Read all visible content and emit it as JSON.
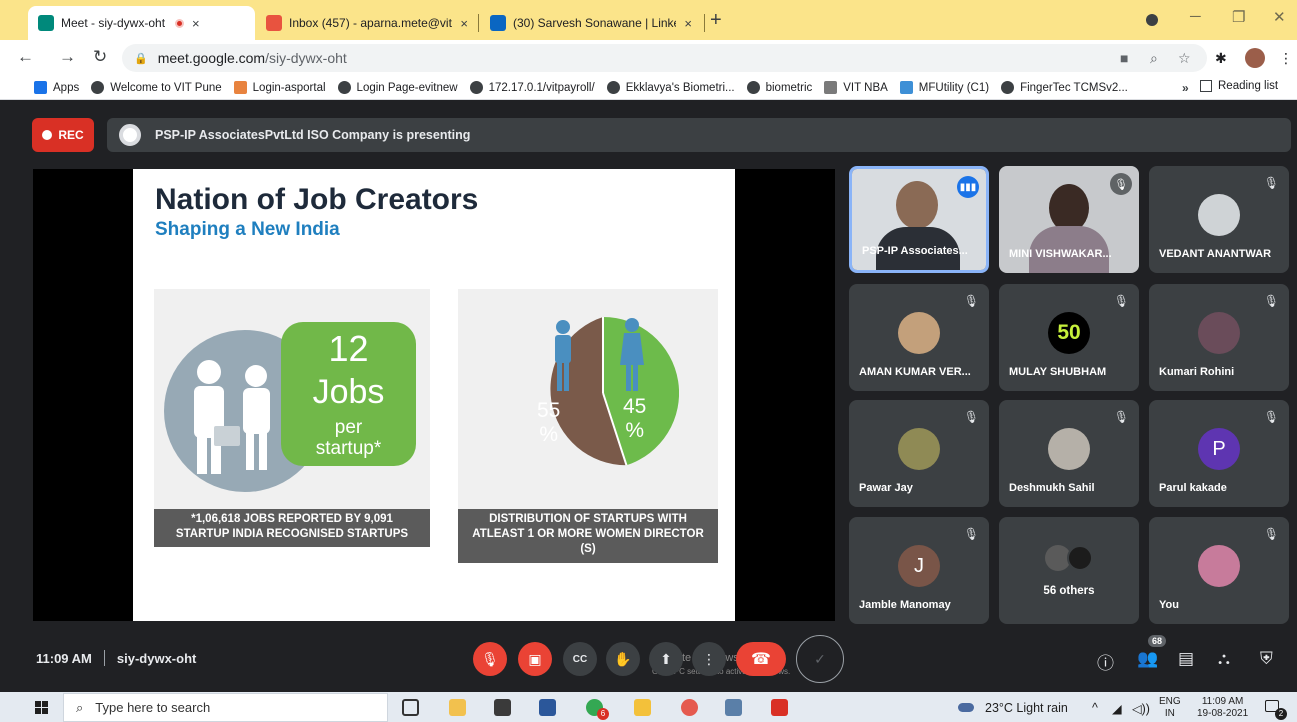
{
  "browser": {
    "tabs": [
      {
        "title": "Meet - siy-dywx-oht",
        "close": "×"
      },
      {
        "title": "Inbox (457) - aparna.mete@vit.e",
        "close": "×"
      },
      {
        "title": "(30) Sarvesh Sonawane | LinkedIn",
        "close": "×"
      }
    ],
    "new_tab": "+",
    "url_host": "meet.google.com",
    "url_path": "/siy-dywx-oht",
    "bookmarks": [
      "Apps",
      "Welcome to VIT Pune",
      "Login-asportal",
      "Login Page-evitnew",
      "172.17.0.1/vitpayroll/",
      "Ekklavya's Biometri...",
      "biometric",
      "VIT NBA",
      "MFUtility (C1)",
      "FingerTec TCMSv2..."
    ],
    "bookmarks_more": "»",
    "reading_list": "Reading list"
  },
  "meet": {
    "rec_label": "REC",
    "presenting_text": "PSP-IP AssociatesPvtLtd ISO Company is presenting",
    "slide": {
      "title": "Nation of Job Creators",
      "subtitle": "Shaping a New India",
      "jobs_number": "12",
      "jobs_label": "Jobs",
      "jobs_per": "per",
      "jobs_startup": "startup*",
      "caption1_line1": "*1,06,618 JOBS REPORTED BY 9,091",
      "caption1_line2": "STARTUP INDIA RECOGNISED STARTUPS",
      "pie_left_num": "55",
      "pie_left_pct": "%",
      "pie_right_num": "45",
      "pie_right_pct": "%",
      "caption2_line1": "DISTRIBUTION OF STARTUPS WITH",
      "caption2_line2": "ATLEAST 1 OR MORE WOMEN DIRECTOR",
      "caption2_line3": "(S)"
    },
    "activate_line1": "Activate Windows",
    "activate_line2": "Go to PC settings to activate Windows.",
    "participants": [
      "PSP-IP Associates...",
      "MINI VISHWAKAR...",
      "VEDANT ANANTWAR",
      "AMAN KUMAR VER...",
      "MULAY SHUBHAM",
      "Kumari Rohini",
      "Pawar Jay",
      "Deshmukh Sahil",
      "Parul kakade",
      "Jamble Manomay",
      "56 others",
      "You"
    ],
    "avatar_letters": {
      "parul": "P",
      "jamble": "J",
      "mulay": "50"
    },
    "time": "11:09 AM",
    "meeting_code": "siy-dywx-oht",
    "participant_count": "68",
    "colors": {
      "rec": "#d93025",
      "end_call": "#ea4335",
      "speaking": "#8ab4f8",
      "jobs_green": "#71b849",
      "pie_brown": "#7a5a4a",
      "pie_green": "#6dbb4b"
    }
  },
  "taskbar": {
    "search_placeholder": "Type here to search",
    "weather": "23°C  Light rain",
    "lang_1": "ENG",
    "lang_2": "IN",
    "clock_time": "11:09 AM",
    "clock_date": "19-08-2021",
    "notif_count": "2",
    "chrome_badge": "6"
  }
}
